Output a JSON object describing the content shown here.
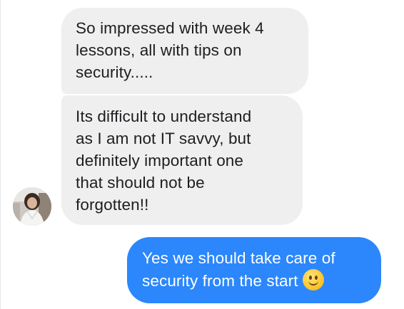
{
  "conversation": {
    "messages": [
      {
        "direction": "incoming",
        "text": "So impressed with week 4\nlessons, all with tips on\nsecurity....."
      },
      {
        "direction": "incoming",
        "text": "Its difficult to understand\nas I am not IT savvy, but\ndefinitely important one\nthat should not be\nforgotten!!"
      },
      {
        "direction": "outgoing",
        "text": "Yes we should take care of\nsecurity from the start",
        "emoji": "slightly-smiling-face-icon"
      }
    ],
    "colors": {
      "incoming_bubble": "#efefef",
      "incoming_text": "#1c1e21",
      "outgoing_bubble": "#2b87fb",
      "outgoing_text": "#ffffff"
    }
  }
}
